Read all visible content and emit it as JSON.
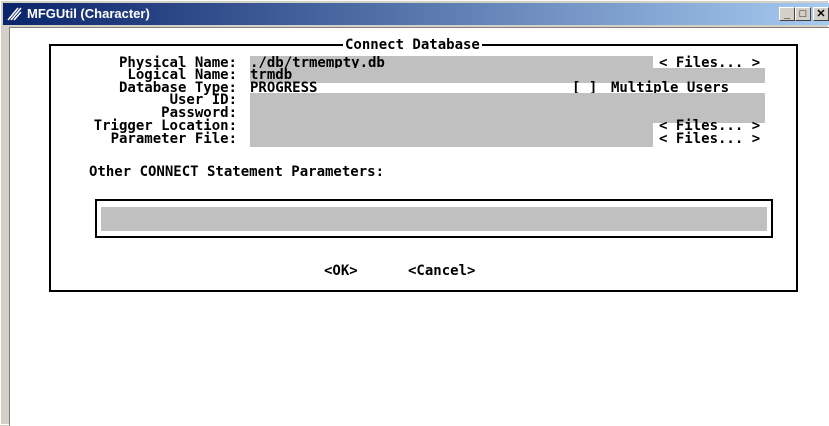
{
  "window": {
    "title": "MFGUtil (Character)",
    "controls": {
      "minimize": "_",
      "maximize": "□",
      "close": "✕"
    }
  },
  "dialog": {
    "title": "Connect Database",
    "fields": {
      "physical_name": {
        "label": "Physical Name:",
        "value": "./db/trmempty.db"
      },
      "logical_name": {
        "label": "Logical Name:",
        "value": "trmdb"
      },
      "database_type": {
        "label": "Database Type:",
        "value": "PROGRESS"
      },
      "user_id": {
        "label": "User ID:",
        "value": ""
      },
      "password": {
        "label": "Password:",
        "value": ""
      },
      "trigger_location": {
        "label": "Trigger Location:",
        "value": ""
      },
      "parameter_file": {
        "label": "Parameter File:",
        "value": ""
      }
    },
    "files_button": "< Files... >",
    "multiple_users": {
      "checkbox": "[ ]",
      "label": "Multiple Users"
    },
    "other_params_label": "Other CONNECT Statement Parameters:",
    "other_params_value": "",
    "ok_button": "<OK>",
    "cancel_button": "<Cancel>"
  },
  "colors": {
    "field_bg": "#c0c0c0",
    "title_start": "#0a246a",
    "title_end": "#a6caf0"
  }
}
